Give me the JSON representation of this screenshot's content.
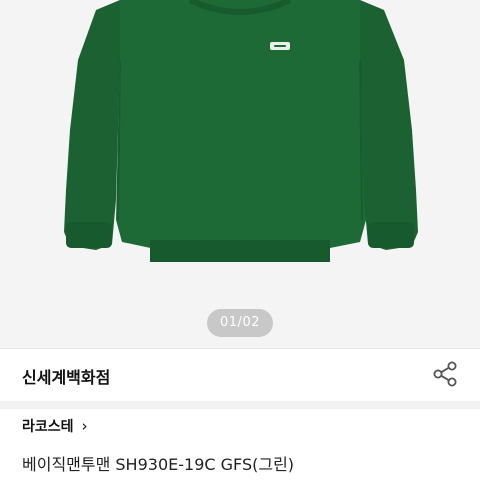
{
  "gallery": {
    "page_indicator": "01/02"
  },
  "store": {
    "name": "신세계백화점"
  },
  "product": {
    "brand": "라코스테",
    "brand_chevron": "›",
    "title": "베이직맨투맨 SH930E-19C GFS(그린)",
    "color": "#1f6b3a"
  },
  "icons": {
    "share": "share-icon",
    "chevron": "chevron-right-icon",
    "logo": "crocodile-logo-icon"
  }
}
